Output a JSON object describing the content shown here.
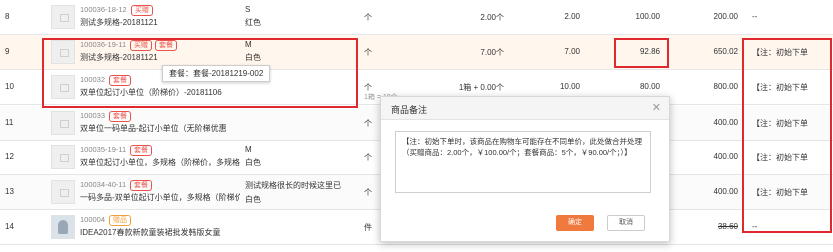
{
  "rows": [
    {
      "idx": "8",
      "code": "100036-18-12",
      "tags": [
        {
          "text": "买赠",
          "kind": "gift"
        }
      ],
      "name": "测试多规格-20181121",
      "spec1": "S",
      "spec2": "红色",
      "unit": "个",
      "unit_sub": "",
      "qty": "2.00个",
      "price": "2.00",
      "actual": "100.00",
      "amount": "200.00",
      "remark": "--"
    },
    {
      "idx": "9",
      "code": "100036-19-11",
      "tags": [
        {
          "text": "买赠",
          "kind": "gift"
        },
        {
          "text": "套餐",
          "kind": "pkg"
        }
      ],
      "name": "测试多规格-20181121",
      "spec1": "M",
      "spec2": "白色",
      "unit": "个",
      "unit_sub": "",
      "qty": "7.00个",
      "price": "7.00",
      "actual": "92.86",
      "amount": "650.02",
      "remark": "【注：初始下单"
    },
    {
      "idx": "10",
      "code": "100032",
      "tags": [
        {
          "text": "套餐",
          "kind": "pkg"
        }
      ],
      "name": "双单位起订小单位（阶梯价）-20181106",
      "spec1": "",
      "spec2": "",
      "unit": "个",
      "unit_sub": "1箱 = 10个",
      "qty": "1箱 + 0.00个",
      "price": "10.00",
      "actual": "80.00",
      "amount": "800.00",
      "remark": "【注：初始下单"
    },
    {
      "idx": "11",
      "code": "100033",
      "tags": [
        {
          "text": "套餐",
          "kind": "pkg"
        }
      ],
      "name": "双单位一码单品-起订小单位（无阶梯优惠",
      "spec1": "",
      "spec2": "",
      "unit": "个",
      "unit_sub": "",
      "qty": "",
      "price": "",
      "actual": "",
      "amount": "400.00",
      "remark": "【注：初始下单"
    },
    {
      "idx": "12",
      "code": "100035-19-11",
      "tags": [
        {
          "text": "套餐",
          "kind": "pkg"
        }
      ],
      "name": "双单位起订小单位，多规格（阶梯价，多规格",
      "spec1": "M",
      "spec2": "白色",
      "unit": "个",
      "unit_sub": "",
      "qty": "",
      "price": "",
      "actual": "",
      "amount": "400.00",
      "remark": "【注：初始下单"
    },
    {
      "idx": "13",
      "code": "100034-40-11",
      "tags": [
        {
          "text": "套餐",
          "kind": "pkg"
        }
      ],
      "name": "一码多品-双单位起订小单位，多规格（阶梯价",
      "spec1": "测试规格很长的时候这里已",
      "spec2": "白色",
      "unit": "个",
      "unit_sub": "",
      "qty": "",
      "price": "",
      "actual": "",
      "amount": "400.00",
      "remark": "【注：初始下单"
    },
    {
      "idx": "14",
      "code": "100004",
      "tags": [
        {
          "text": "赠品",
          "kind": "gift"
        }
      ],
      "name": "IDEA2017春款新款童装裙批发韩版女童",
      "spec1": "",
      "spec2": "",
      "unit": "件",
      "unit_sub": "",
      "qty": "",
      "price": "",
      "actual": "",
      "amount": "38.60",
      "remark": "--"
    }
  ],
  "tooltip": "套餐：套餐-20181219-002",
  "modal": {
    "title": "商品备注",
    "text": "【注：初始下单时，该商品在购物车可能存在不同单价，此处做合并处理（买赠商品：2.00个，￥100.00/个；套餐商品：5个，￥90.00/个；）】",
    "ok_label": "确定",
    "cancel_label": "取消"
  },
  "colors": {
    "accent": "#f07a3e",
    "highlight": "#e0282e",
    "tag": "#e8534b"
  }
}
